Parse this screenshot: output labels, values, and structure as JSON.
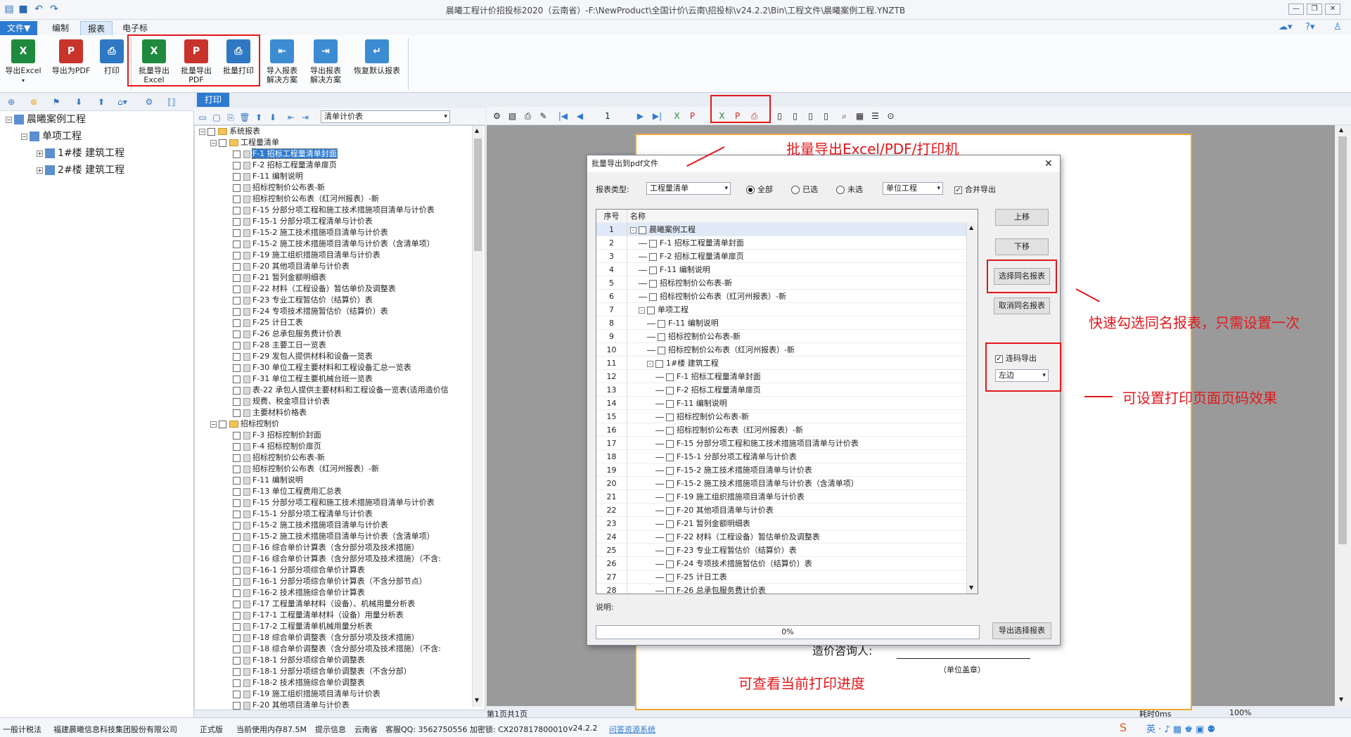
{
  "window": {
    "title": "晨曦工程计价招投标2020（云南省）-F:\\NewProduct\\全国计价\\云南\\招投标\\v24.2.2\\Bin\\工程文件\\晨曦案例工程.YNZTB"
  },
  "menu": [
    "文件▼",
    "编制",
    "报表",
    "电子标"
  ],
  "ribbon": {
    "export_excel": "导出Excel",
    "export_pdf": "导出为PDF",
    "print": "打印",
    "batch_excel": [
      "批量导出",
      "Excel"
    ],
    "batch_pdf": [
      "批量导出",
      "PDF"
    ],
    "batch_print": "批量打印",
    "import_scheme": [
      "导入报表",
      "解决方案"
    ],
    "export_scheme": [
      "导出报表",
      "解决方案"
    ],
    "restore_default": "恢复默认报表"
  },
  "project_tree": [
    {
      "label": "晨曦案例工程",
      "level": 0
    },
    {
      "label": "单项工程",
      "level": 1
    },
    {
      "label": "1#楼  建筑工程",
      "level": 2
    },
    {
      "label": "2#楼  建筑工程",
      "level": 2
    }
  ],
  "print_tab": "打印",
  "report_category_select": "清单计价表",
  "report_tree": {
    "root": "系统报表",
    "group1": "工程量清单",
    "group1_items": [
      "F-1 招标工程量清单封面",
      "F-2 招标工程量清单扉页",
      "F-11 编制说明",
      "招标控制价公布表-新",
      "招标控制价公布表（红河州报表）-新",
      "F-15 分部分项工程和施工技术措施项目清单与计价表",
      "F-15-1 分部分项工程清单与计价表",
      "F-15-2 施工技术措施项目清单与计价表",
      "F-15-2 施工技术措施项目清单与计价表（含清单项）",
      "F-19 施工组织措施项目清单与计价表",
      "F-20 其他项目清单与计价表",
      "F-21 暂列金额明细表",
      "F-22 材料（工程设备）暂估单价及调整表",
      "F-23 专业工程暂估价（结算价）表",
      "F-24 专项技术措施暂估价（结算价）表",
      "F-25 计日工表",
      "F-26 总承包服务费计价表",
      "F-28 主要工日一览表",
      "F-29 发包人提供材料和设备一览表",
      "F-30 单位工程主要材料和工程设备汇总一览表",
      "F-31 单位工程主要机械台班一览表",
      "表-22 承包人提供主要材料和工程设备一览表(适用造价信",
      "规费、税金项目计价表",
      "主要材料价格表"
    ],
    "group2": "招标控制价",
    "group2_items": [
      "F-3 招标控制价封面",
      "F-4 招标控制价扉页",
      "招标控制价公布表-新",
      "招标控制价公布表（红河州报表）-新",
      "F-11 编制说明",
      "F-13 单位工程费用汇总表",
      "F-15 分部分项工程和施工技术措施项目清单与计价表",
      "F-15-1 分部分项工程清单与计价表",
      "F-15-2 施工技术措施项目清单与计价表",
      "F-15-2 施工技术措施项目清单与计价表（含清单项）",
      "F-16 综合单价计算表（含分部分项及技术措施）",
      "F-16 综合单价计算表（含分部分项及技术措施）（不含:",
      "F-16-1 分部分项综合单价计算表",
      "F-16-1 分部分项综合单价计算表（不含分部节点）",
      "F-16-2 技术措施综合单价计算表",
      "F-17 工程量清单材料（设备）、机械用量分析表",
      "F-17-1 工程量清单材料（设备）用量分析表",
      "F-17-2 工程量清单机械用量分析表",
      "F-18 综合单价调整表（含分部分项及技术措施）",
      "F-18 综合单价调整表（含分部分项及技术措施）（不含:",
      "F-18-1 分部分项综合单价调整表",
      "F-18-1 分部分项综合单价调整表（不含分部）",
      "F-18-2 技术措施综合单价调整表",
      "F-19 施工组织措施项目清单与计价表",
      "F-20 其他项目清单与计价表"
    ]
  },
  "preview_toolbar": {
    "page_number": "1"
  },
  "dialog": {
    "title": "批量导出到pdf文件",
    "report_type_label": "报表类型:",
    "report_type_value": "工程量清单",
    "radios": [
      "全部",
      "已选",
      "未选"
    ],
    "radio_selected": "全部",
    "scope_value": "单位工程",
    "merge_export": "合并导出",
    "columns": [
      "序号",
      "名称"
    ],
    "rows": [
      {
        "n": "1",
        "name": "晨曦案例工程",
        "indent": 0,
        "exp": "-"
      },
      {
        "n": "2",
        "name": "F-1 招标工程量清单封面",
        "indent": 1
      },
      {
        "n": "3",
        "name": "F-2 招标工程量清单扉页",
        "indent": 1
      },
      {
        "n": "4",
        "name": "F-11 编制说明",
        "indent": 1
      },
      {
        "n": "5",
        "name": "招标控制价公布表-新",
        "indent": 1
      },
      {
        "n": "6",
        "name": "招标控制价公布表（红河州报表）-新",
        "indent": 1
      },
      {
        "n": "7",
        "name": "单项工程",
        "indent": 1,
        "exp": "-"
      },
      {
        "n": "8",
        "name": "F-11 编制说明",
        "indent": 2
      },
      {
        "n": "9",
        "name": "招标控制价公布表-新",
        "indent": 2
      },
      {
        "n": "10",
        "name": "招标控制价公布表（红河州报表）-新",
        "indent": 2
      },
      {
        "n": "11",
        "name": "1#楼 建筑工程",
        "indent": 2,
        "exp": "-"
      },
      {
        "n": "12",
        "name": "F-1 招标工程量清单封面",
        "indent": 3
      },
      {
        "n": "13",
        "name": "F-2 招标工程量清单扉页",
        "indent": 3
      },
      {
        "n": "14",
        "name": "F-11 编制说明",
        "indent": 3
      },
      {
        "n": "15",
        "name": "招标控制价公布表-新",
        "indent": 3
      },
      {
        "n": "16",
        "name": "招标控制价公布表（红河州报表）-新",
        "indent": 3
      },
      {
        "n": "17",
        "name": "F-15 分部分项工程和施工技术措施项目清单与计价表",
        "indent": 3
      },
      {
        "n": "18",
        "name": "F-15-1 分部分项工程清单与计价表",
        "indent": 3
      },
      {
        "n": "19",
        "name": "F-15-2 施工技术措施项目清单与计价表",
        "indent": 3
      },
      {
        "n": "20",
        "name": "F-15-2 施工技术措施项目清单与计价表（含清单项）",
        "indent": 3
      },
      {
        "n": "21",
        "name": "F-19 施工组织措施项目清单与计价表",
        "indent": 3
      },
      {
        "n": "22",
        "name": "F-20 其他项目清单与计价表",
        "indent": 3
      },
      {
        "n": "23",
        "name": "F-21 暂列金额明细表",
        "indent": 3
      },
      {
        "n": "24",
        "name": "F-22 材料（工程设备）暂估单价及调整表",
        "indent": 3
      },
      {
        "n": "25",
        "name": "F-23 专业工程暂估价（结算价）表",
        "indent": 3
      },
      {
        "n": "26",
        "name": "F-24 专项技术措施暂估价（结算价）表",
        "indent": 3
      },
      {
        "n": "27",
        "name": "F-25 计日工表",
        "indent": 3
      },
      {
        "n": "28",
        "name": "F-26 总承包服务费计价表",
        "indent": 3
      }
    ],
    "btn_up": "上移",
    "btn_down": "下移",
    "btn_select_same": "选择同名报表",
    "btn_cancel_same": "取消同名报表",
    "continuous_export": "连码导出",
    "page_pos": "左边",
    "note_label": "说明:",
    "progress": 0,
    "progress_text": "0%",
    "btn_export": "导出选择报表"
  },
  "annotations": {
    "batch": "批量导出Excel/PDF/打印机",
    "same_name": "快速勾选同名报表，只需设置一次",
    "page_number": "可设置打印页面页码效果",
    "progress": "可查看当前打印进度"
  },
  "paper": {
    "text1": "造价咨询人:",
    "text2": "（单位盖章）"
  },
  "status": {
    "tax": "一般计税法",
    "company": "福建晨曦信息科技集团股份有限公司",
    "edition": "正式版",
    "memory": "当前使用内存87.5M",
    "hint": "提示信息",
    "province": "云南省",
    "qq": "客服QQ: 3562750556",
    "lock": "加密锁: CX207817800010",
    "version": "v24.2.2",
    "qa": "问答资源系统",
    "pages": "第1页共1页",
    "time": "耗时0ms",
    "zoom": "100%"
  },
  "colors": {
    "accent": "#2d7bd0",
    "highlight_red": "#e1191c"
  }
}
